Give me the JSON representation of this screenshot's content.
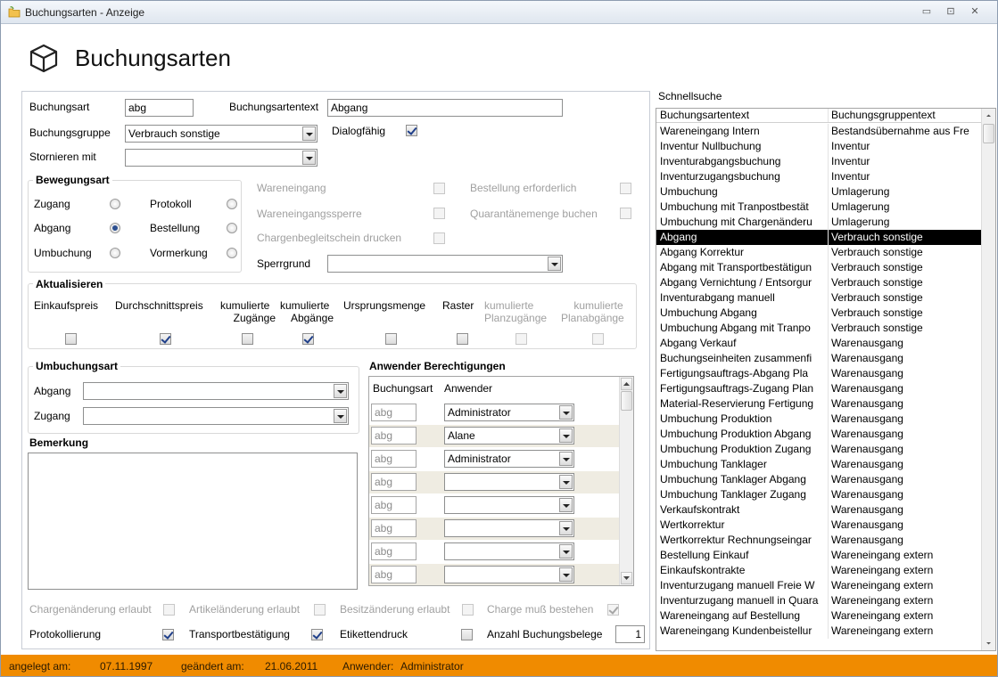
{
  "window": {
    "title": "Buchungsarten - Anzeige",
    "heading": "Buchungsarten"
  },
  "form": {
    "buchungsart": {
      "label": "Buchungsart",
      "value": "abg"
    },
    "buchungsartentext": {
      "label": "Buchungsartentext",
      "value": "Abgang"
    },
    "buchungsgruppe": {
      "label": "Buchungsgruppe",
      "value": "Verbrauch sonstige"
    },
    "dialogfaehig": {
      "label": "Dialogfähig",
      "checked": true
    },
    "stornieren_mit": {
      "label": "Stornieren mit",
      "value": ""
    }
  },
  "bewegungsart": {
    "title": "Bewegungsart",
    "options": [
      {
        "label": "Zugang",
        "selected": false
      },
      {
        "label": "Abgang",
        "selected": true
      },
      {
        "label": "Umbuchung",
        "selected": false
      },
      {
        "label": "Protokoll",
        "selected": false
      },
      {
        "label": "Bestellung",
        "selected": false
      },
      {
        "label": "Vormerkung",
        "selected": false
      }
    ]
  },
  "options_right": {
    "wareneingang": "Wareneingang",
    "bestellung_erforderlich": "Bestellung erforderlich",
    "wareneingangssperre": "Wareneingangssperre",
    "quarantaene": "Quarantänemenge buchen",
    "chargenbegleitschein": "Chargenbegleitschein drucken",
    "sperrgrund": {
      "label": "Sperrgrund",
      "value": ""
    }
  },
  "aktualisieren": {
    "title": "Aktualisieren",
    "items": [
      {
        "line1": "Einkaufspreis",
        "line2": "",
        "checked": false,
        "enabled": true
      },
      {
        "line1": "Durchschnittspreis",
        "line2": "",
        "checked": true,
        "enabled": true
      },
      {
        "line1": "kumulierte",
        "line2": "Zugänge",
        "checked": false,
        "enabled": true
      },
      {
        "line1": "kumulierte",
        "line2": "Abgänge",
        "checked": true,
        "enabled": true
      },
      {
        "line1": "Ursprungsmenge",
        "line2": "",
        "checked": false,
        "enabled": true
      },
      {
        "line1": "Raster",
        "line2": "",
        "checked": false,
        "enabled": true
      },
      {
        "line1": "kumulierte",
        "line2": "Planzugänge",
        "checked": false,
        "enabled": false
      },
      {
        "line1": "kumulierte",
        "line2": "Planabgänge",
        "checked": false,
        "enabled": false
      }
    ]
  },
  "umbuchungsart": {
    "title": "Umbuchungsart",
    "abgang": {
      "label": "Abgang",
      "value": ""
    },
    "zugang": {
      "label": "Zugang",
      "value": ""
    }
  },
  "bemerkung": {
    "title": "Bemerkung",
    "value": ""
  },
  "anwender": {
    "title": "Anwender Berechtigungen",
    "columns": [
      "Buchungsart",
      "Anwender"
    ],
    "rows": [
      {
        "buchungsart": "abg",
        "anwender": "Administrator"
      },
      {
        "buchungsart": "abg",
        "anwender": "Alane"
      },
      {
        "buchungsart": "abg",
        "anwender": "Administrator"
      },
      {
        "buchungsart": "abg",
        "anwender": ""
      },
      {
        "buchungsart": "abg",
        "anwender": ""
      },
      {
        "buchungsart": "abg",
        "anwender": ""
      },
      {
        "buchungsart": "abg",
        "anwender": ""
      },
      {
        "buchungsart": "abg",
        "anwender": ""
      }
    ]
  },
  "bottom": {
    "chargenaenderung": "Chargenänderung erlaubt",
    "artikelaenderung": "Artikeländerung erlaubt",
    "besitzaenderung": "Besitzänderung erlaubt",
    "charge_muss": "Charge muß bestehen",
    "protokollierung": "Protokollierung",
    "transportbestaetigung": "Transportbestätigung",
    "etikettendruck": "Etikettendruck",
    "anzahl_belege": {
      "label": "Anzahl Buchungsbelege",
      "value": "1"
    }
  },
  "schnellsuche": {
    "title": "Schnellsuche",
    "columns": [
      "Buchungsartentext",
      "Buchungsgruppentext"
    ],
    "rows": [
      [
        "Wareneingang Intern",
        "Bestandsübernahme aus Fre"
      ],
      [
        "Inventur Nullbuchung",
        "Inventur"
      ],
      [
        "Inventurabgangsbuchung",
        "Inventur"
      ],
      [
        "Inventurzugangsbuchung",
        "Inventur"
      ],
      [
        "Umbuchung",
        "Umlagerung"
      ],
      [
        "Umbuchung  mit Tranpostbestät",
        "Umlagerung"
      ],
      [
        "Umbuchung mit Chargenänderu",
        "Umlagerung"
      ],
      [
        "Abgang",
        "Verbrauch sonstige"
      ],
      [
        "Abgang Korrektur",
        "Verbrauch sonstige"
      ],
      [
        "Abgang mit Transportbestätigun",
        "Verbrauch sonstige"
      ],
      [
        "Abgang Vernichtung / Entsorgur",
        "Verbrauch sonstige"
      ],
      [
        "Inventurabgang manuell",
        "Verbrauch sonstige"
      ],
      [
        "Umbuchung Abgang",
        "Verbrauch sonstige"
      ],
      [
        "Umbuchung Abgang mit Tranpo",
        "Verbrauch sonstige"
      ],
      [
        "Abgang Verkauf",
        "Warenausgang"
      ],
      [
        "Buchungseinheiten zusammenfi",
        "Warenausgang"
      ],
      [
        "Fertigungsauftrags-Abgang  Pla",
        "Warenausgang"
      ],
      [
        "Fertigungsauftrags-Zugang Plan",
        "Warenausgang"
      ],
      [
        "Material-Reservierung Fertigung",
        "Warenausgang"
      ],
      [
        "Umbuchung Produktion",
        "Warenausgang"
      ],
      [
        "Umbuchung Produktion Abgang",
        "Warenausgang"
      ],
      [
        "Umbuchung Produktion Zugang",
        "Warenausgang"
      ],
      [
        "Umbuchung Tanklager",
        "Warenausgang"
      ],
      [
        "Umbuchung Tanklager Abgang",
        "Warenausgang"
      ],
      [
        "Umbuchung Tanklager Zugang",
        "Warenausgang"
      ],
      [
        "Verkaufskontrakt",
        "Warenausgang"
      ],
      [
        "Wertkorrektur",
        "Warenausgang"
      ],
      [
        "Wertkorrektur Rechnungseingar",
        "Warenausgang"
      ],
      [
        "Bestellung Einkauf",
        "Wareneingang extern"
      ],
      [
        "Einkaufskontrakte",
        "Wareneingang extern"
      ],
      [
        "Inventurzugang manuell Freie W",
        "Wareneingang extern"
      ],
      [
        "Inventurzugang manuell in Quara",
        "Wareneingang extern"
      ],
      [
        "Wareneingang auf Bestellung",
        "Wareneingang extern"
      ],
      [
        "Wareneingang Kundenbeistellur",
        "Wareneingang extern"
      ]
    ],
    "selected_index": 7
  },
  "status": {
    "angelegt_label": "angelegt am:",
    "angelegt_value": "07.11.1997",
    "geaendert_label": "geändert am:",
    "geaendert_value": "21.06.2011",
    "anwender_label": "Anwender:",
    "anwender_value": "Administrator"
  },
  "colors": {
    "status_bar": "#f08b00",
    "selection": "#000000"
  }
}
